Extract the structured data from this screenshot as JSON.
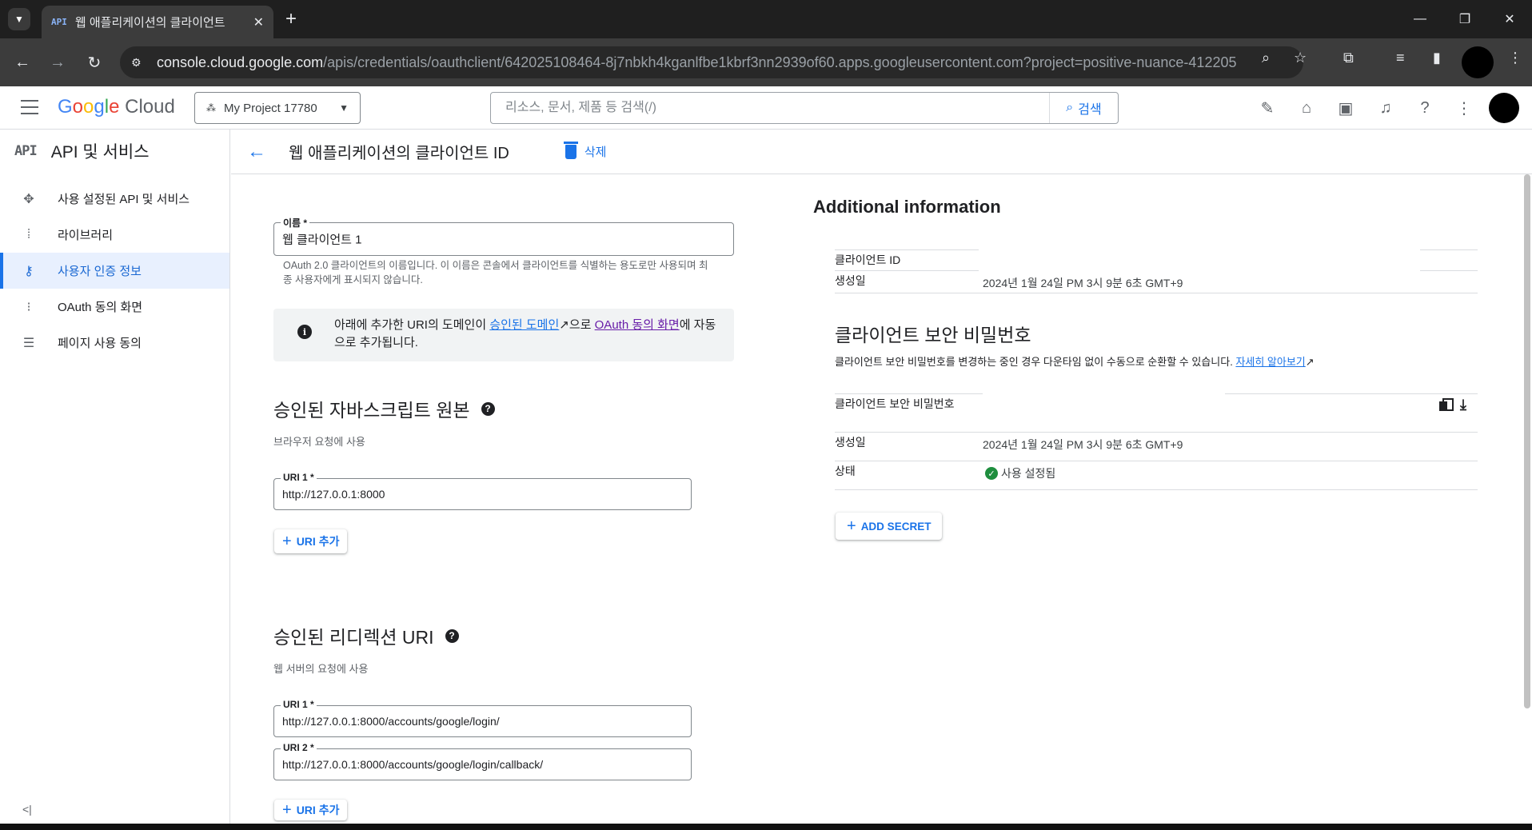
{
  "browser": {
    "tab_favicon": "API",
    "tab_title": "웹 애플리케이션의 클라이언트",
    "url_host": "console.cloud.google.com",
    "url_path": "/apis/credentials/oauthclient/642025108464-8j7nbkh4kganlfbe1kbrf3nn2939of60.apps.googleusercontent.com?project=positive-nuance-412205"
  },
  "header": {
    "logo_google": [
      "G",
      "o",
      "o",
      "g",
      "l",
      "e"
    ],
    "logo_cloud": "Cloud",
    "project_name": "My Project 17780",
    "search_placeholder": "리소스, 문서, 제품 등 검색(/)",
    "search_button": "검색"
  },
  "sidebar": {
    "title_icon": "API",
    "title": "API 및 서비스",
    "items": [
      {
        "label": "사용 설정된 API 및 서비스",
        "icon": "enabled-apis-icon"
      },
      {
        "label": "라이브러리",
        "icon": "library-icon"
      },
      {
        "label": "사용자 인증 정보",
        "icon": "key-icon"
      },
      {
        "label": "OAuth 동의 화면",
        "icon": "consent-icon"
      },
      {
        "label": "페이지 사용 동의",
        "icon": "page-usage-icon"
      }
    ]
  },
  "page": {
    "title": "웹 애플리케이션의 클라이언트 ID",
    "delete_label": "삭제"
  },
  "form": {
    "name_label": "이름 *",
    "name_value": "웹 클라이언트 1",
    "name_helper": "OAuth 2.0 클라이언트의 이름입니다. 이 이름은 콘솔에서 클라이언트를 식별하는 용도로만 사용되며 최종 사용자에게 표시되지 않습니다.",
    "info_prefix": "아래에 추가한 URI의 도메인이 ",
    "info_link1": "승인된 도메인",
    "info_mid": "으로 ",
    "info_link2": "OAuth 동의 화면",
    "info_suffix": "에 자동으로 추가됩니다.",
    "js_origins_title": "승인된 자바스크립트 원본",
    "js_origins_sub": "브라우저 요청에 사용",
    "js_uri1_label": "URI 1 *",
    "js_uri1_value": "http://127.0.0.1:8000",
    "add_uri": "URI 추가",
    "redirect_title": "승인된 리디렉션 URI",
    "redirect_sub": "웹 서버의 요청에 사용",
    "redirect_uri1_label": "URI 1 *",
    "redirect_uri1_value": "http://127.0.0.1:8000/accounts/google/login/",
    "redirect_uri2_label": "URI 2 *",
    "redirect_uri2_value": "http://127.0.0.1:8000/accounts/google/login/callback/"
  },
  "additional": {
    "title": "Additional information",
    "client_id_label": "클라이언트 ID",
    "created_label": "생성일",
    "created_value": "2024년 1월 24일 PM 3시 9분 6초 GMT+9",
    "secret_title": "클라이언트 보안 비밀번호",
    "secret_desc": "클라이언트 보안 비밀번호를 변경하는 중인 경우 다운타임 없이 수동으로 순환할 수 있습니다. ",
    "secret_desc_link": "자세히 알아보기",
    "secret_label": "클라이언트 보안 비밀번호",
    "secret_created_label": "생성일",
    "secret_created_value": "2024년 1월 24일 PM 3시 9분 6초 GMT+9",
    "status_label": "상태",
    "status_value": "사용 설정됨",
    "add_secret": "ADD SECRET"
  },
  "colors": {
    "accent": "#1a73e8",
    "active_bg": "#e8f0fe",
    "success": "#1e8e3e"
  }
}
